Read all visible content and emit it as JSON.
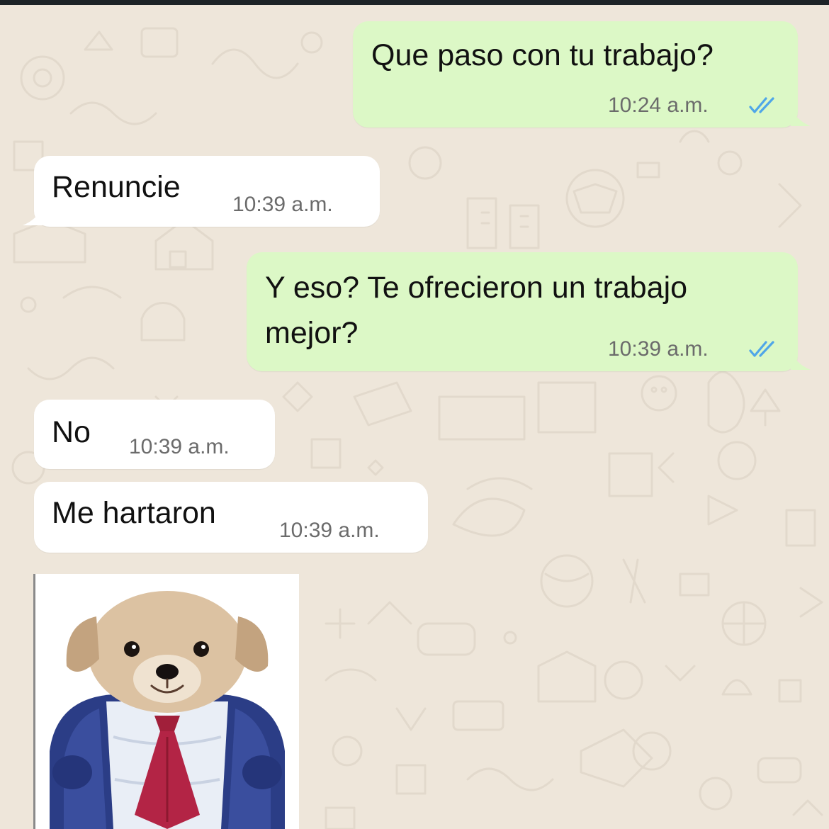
{
  "colors": {
    "wallpaper": "#eee6da",
    "outgoing_bubble": "#dcf8c6",
    "incoming_bubble": "#ffffff",
    "read_ticks": "#4fa6e8",
    "timestamp": "#6b6b6b"
  },
  "messages": [
    {
      "direction": "outgoing",
      "lines": [
        "Que paso con tu trabajo?"
      ],
      "time": "10:24 a.m.",
      "status": "read"
    },
    {
      "direction": "incoming",
      "lines": [
        "Renuncie"
      ],
      "time": "10:39 a.m."
    },
    {
      "direction": "outgoing",
      "lines": [
        "Y eso? Te ofrecieron un trabajo",
        "mejor?"
      ],
      "time": "10:39 a.m.",
      "status": "read"
    },
    {
      "direction": "incoming",
      "lines": [
        "No"
      ],
      "time": "10:39 a.m."
    },
    {
      "direction": "incoming",
      "lines": [
        "Me hartaron"
      ],
      "time": "10:39 a.m."
    },
    {
      "direction": "incoming",
      "type": "sticker",
      "sticker": "puppy-in-business-suit"
    }
  ]
}
